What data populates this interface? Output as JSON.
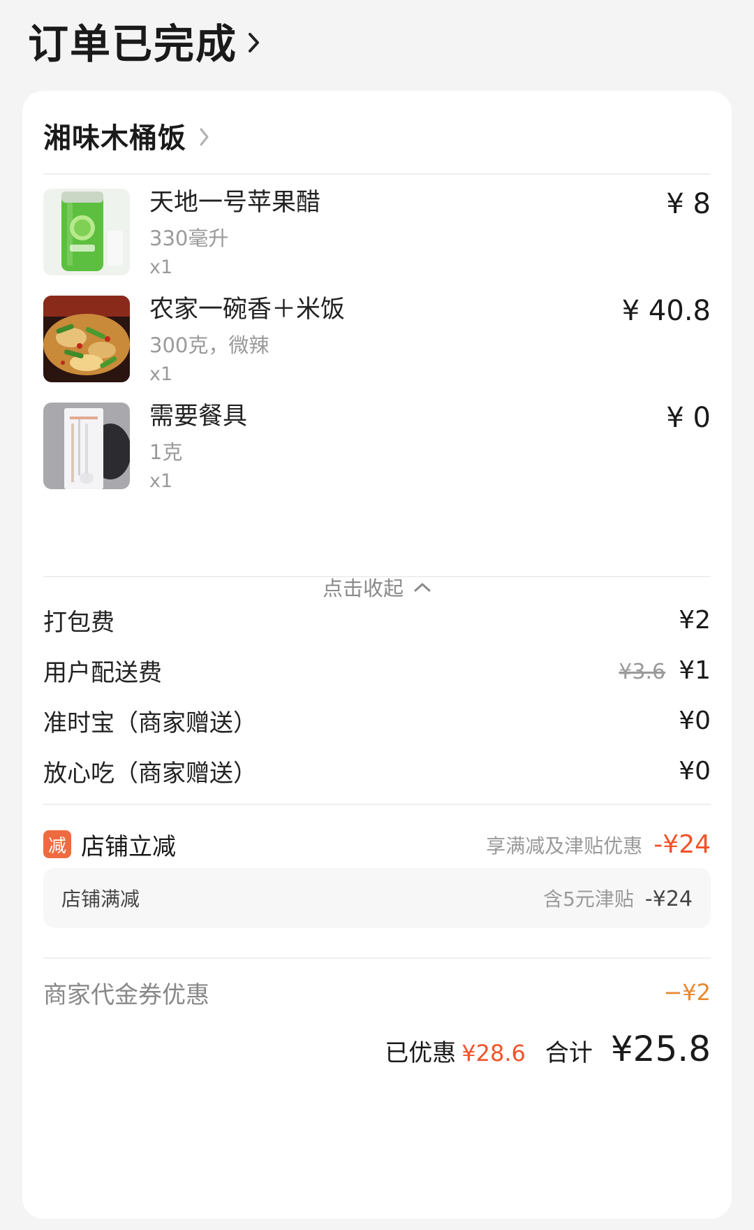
{
  "header": {
    "title": "订单已完成"
  },
  "store": {
    "name": "湘味木桶饭"
  },
  "items": [
    {
      "name": "天地一号苹果醋",
      "spec": "330毫升",
      "qty": "x1",
      "price": "¥ 8",
      "image": "apple-vinegar-can"
    },
    {
      "name": "农家一碗香＋米饭",
      "spec": "300克，微辣",
      "qty": "x1",
      "price": "¥ 40.8",
      "image": "stir-fry-dish"
    },
    {
      "name": "需要餐具",
      "spec": "1克",
      "qty": "x1",
      "price": "¥ 0",
      "image": "cutlery-pack"
    }
  ],
  "collapse": {
    "label": "点击收起"
  },
  "fees": [
    {
      "label": "打包费",
      "value": "¥2"
    },
    {
      "label": "用户配送费",
      "original": "¥3.6",
      "value": "¥1"
    },
    {
      "label": "准时宝（商家赠送）",
      "value": "¥0"
    },
    {
      "label": "放心吃（商家赠送）",
      "value": "¥0"
    }
  ],
  "discount": {
    "badge": "减",
    "title": "店铺立减",
    "note": "享满减及津贴优惠",
    "amount": "-¥24",
    "detail": {
      "label": "店铺满减",
      "note": "含5元津贴",
      "amount": "-¥24"
    }
  },
  "coupon": {
    "label": "商家代金券优惠",
    "amount": "−¥2"
  },
  "summary": {
    "saved_label": "已优惠",
    "saved_amount": "¥28.6",
    "total_label": "合计",
    "total_amount": "¥25.8"
  },
  "colors": {
    "accent": "#f0542a",
    "badge": "#ef6b3f",
    "coupon": "#e8892f",
    "background": "#f4f4f4",
    "card": "#ffffff"
  }
}
